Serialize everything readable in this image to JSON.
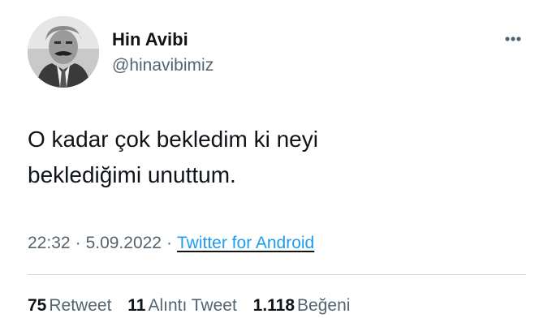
{
  "author": {
    "display_name": "Hin Avibi",
    "handle": "@hinavibimiz",
    "avatar_icon": "profile-photo"
  },
  "menu": {
    "more_icon": "more-horizontal-icon"
  },
  "tweet": {
    "text_line_1": "O kadar çok bekledim ki neyi",
    "text_line_2": "beklediğimi unuttum."
  },
  "meta": {
    "time": "22:32",
    "separator": "·",
    "date": "5.09.2022",
    "source": "Twitter for Android"
  },
  "stats": {
    "retweets": {
      "count": "75",
      "label": "Retweet"
    },
    "quotes": {
      "count": "11",
      "label": "Alıntı Tweet"
    },
    "likes": {
      "count": "1.118",
      "label": "Beğeni"
    }
  },
  "colors": {
    "text_primary": "#0f1419",
    "text_secondary": "#536471",
    "link": "#1d9bf0",
    "divider": "#cfd9de"
  }
}
